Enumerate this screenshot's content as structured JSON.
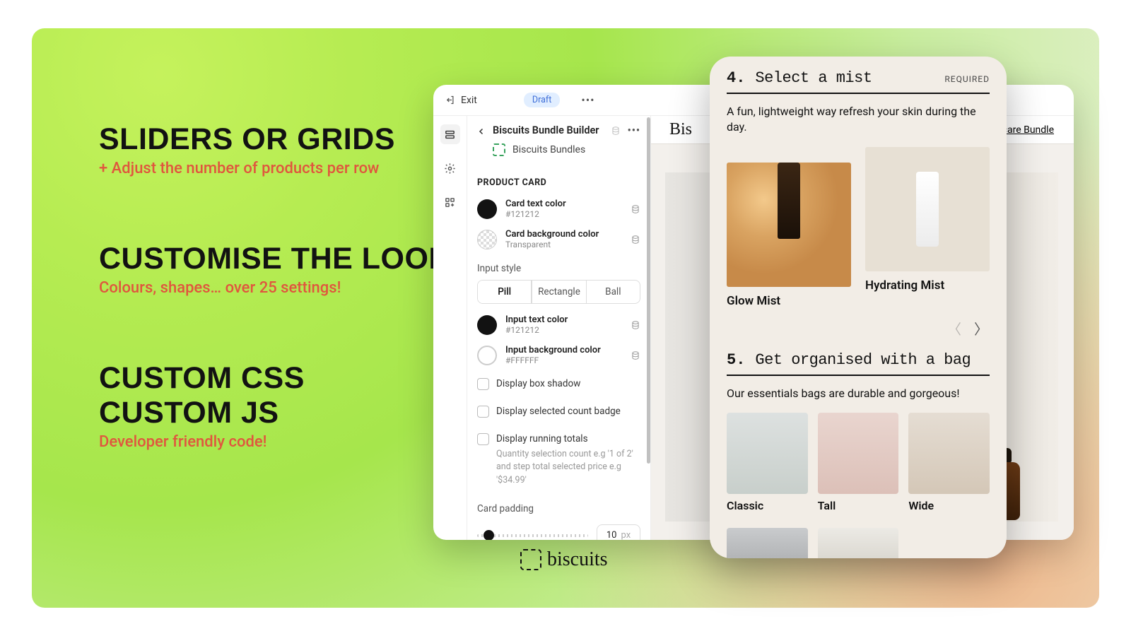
{
  "hero": {
    "block1": {
      "title": "SLIDERS OR GRIDS",
      "sub": "+ Adjust the number of products per row"
    },
    "block2": {
      "title": "CUSTOMISE THE LOOK",
      "sub": "Colours, shapes… over 25 settings!"
    },
    "block3": {
      "title_l1": "CUSTOM CSS",
      "title_l2": "CUSTOM JS",
      "sub": "Developer friendly code!"
    }
  },
  "editor": {
    "exit": "Exit",
    "draft": "Draft",
    "panel_title": "Biscuits Bundle Builder",
    "app_name": "Biscuits Bundles",
    "section": "PRODUCT CARD",
    "colors": {
      "card_text": {
        "label": "Card text color",
        "value": "#121212"
      },
      "card_bg": {
        "label": "Card background color",
        "value": "Transparent"
      },
      "input_text": {
        "label": "Input text color",
        "value": "#121212"
      },
      "input_bg": {
        "label": "Input background color",
        "value": "#FFFFFF"
      }
    },
    "input_style_label": "Input style",
    "input_style": {
      "opt1": "Pill",
      "opt2": "Rectangle",
      "opt3": "Ball"
    },
    "checks": {
      "shadow": "Display box shadow",
      "badge": "Display selected count badge",
      "totals": "Display running totals",
      "totals_help": "Quantity selection count e.g '1 of 2' and step total selected price e.g '$34.99'"
    },
    "padding_label": "Card padding",
    "padding_val": "10",
    "padding_unit": "px"
  },
  "preview": {
    "title": "Bis",
    "link": "Skincare Bundle"
  },
  "mobile": {
    "step4": {
      "num": "4.",
      "title": "Select a mist",
      "req": "REQUIRED",
      "desc": "A fun, lightweight way refresh your skin during the day.",
      "p1": "Glow Mist",
      "p2": "Hydrating Mist"
    },
    "step5": {
      "num": "5.",
      "title": "Get organised with a bag",
      "desc": "Our essentials bags are durable and gorgeous!",
      "b1": "Classic",
      "b2": "Tall",
      "b3": "Wide"
    }
  },
  "brand": "biscuits"
}
